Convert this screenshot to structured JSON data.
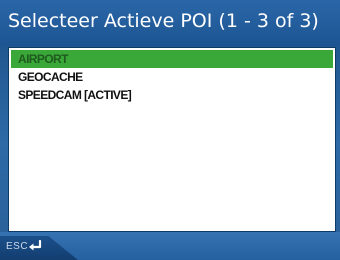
{
  "header": {
    "title": "Selecteer Actieve POI (1 - 3 of 3)"
  },
  "poi_list": {
    "items": [
      {
        "label": "AIRPORT",
        "selected": true
      },
      {
        "label": "GEOCACHE",
        "selected": false
      },
      {
        "label": "SPEEDCAM [ACTIVE]",
        "selected": false
      }
    ]
  },
  "footer": {
    "esc_label": "ESC",
    "enter_icon": "enter-arrow-icon"
  },
  "colors": {
    "title_bar": "#2a66a8",
    "selection_highlight": "#3aa838",
    "list_background": "#ffffff",
    "bottom_bar": "#2d6aa6"
  }
}
